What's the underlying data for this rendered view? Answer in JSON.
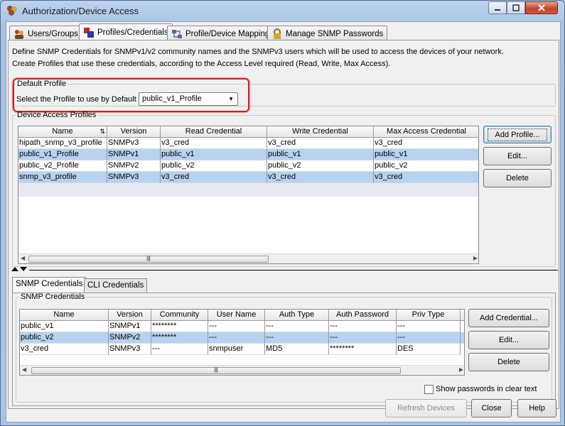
{
  "window": {
    "title": "Authorization/Device Access"
  },
  "tabs": [
    {
      "label": "Users/Groups",
      "icon": "users-icon"
    },
    {
      "label": "Profiles/Credentials",
      "icon": "profiles-icon"
    },
    {
      "label": "Profile/Device Mapping",
      "icon": "mapping-icon"
    },
    {
      "label": "Manage SNMP Passwords",
      "icon": "lock-icon"
    }
  ],
  "description": {
    "line1": "Define SNMP Credentials for SNMPv1/v2 community names and the SNMPv3 users which will be used to access the devices of your network.",
    "line2": "Create Profiles that use these credentials, according to the Access Level required (Read, Write, Max Access)."
  },
  "default_profile": {
    "legend": "Default Profile",
    "label": "Select the Profile to use by Default",
    "selected": "public_v1_Profile"
  },
  "device_profiles": {
    "legend": "Device Access Profiles",
    "columns": [
      "Name",
      "Version",
      "Read Credential",
      "Write Credential",
      "Max Access Credential"
    ],
    "rows": [
      [
        "hipath_snmp_v3_profile",
        "SNMPv3",
        "v3_cred",
        "v3_cred",
        "v3_cred"
      ],
      [
        "public_v1_Profile",
        "SNMPv1",
        "public_v1",
        "public_v1",
        "public_v1"
      ],
      [
        "public_v2_Profile",
        "SNMPv2",
        "public_v2",
        "public_v2",
        "public_v2"
      ],
      [
        "snmp_v3_profile",
        "SNMPv3",
        "v3_cred",
        "v3_cred",
        "v3_cred"
      ]
    ],
    "buttons": {
      "add": "Add Profile...",
      "edit": "Edit...",
      "delete": "Delete"
    }
  },
  "subtabs": [
    "SNMP Credentials",
    "CLI Credentials"
  ],
  "snmp_credentials": {
    "legend": "SNMP Credentials",
    "columns": [
      "Name",
      "Version",
      "Community",
      "User Name",
      "Auth Type",
      "Auth Password",
      "Priv Type"
    ],
    "rows": [
      [
        "public_v1",
        "SNMPv1",
        "********",
        "---",
        "---",
        "---",
        "---"
      ],
      [
        "public_v2",
        "SNMPv2",
        "********",
        "---",
        "---",
        "---",
        "---"
      ],
      [
        "v3_cred",
        "SNMPv3",
        "---",
        "snmpuser",
        "MD5",
        "********",
        "DES"
      ]
    ],
    "buttons": {
      "add": "Add Credential...",
      "edit": "Edit...",
      "delete": "Delete"
    },
    "show_passwords": "Show passwords in clear text"
  },
  "footer": {
    "refresh": "Refresh Devices",
    "close": "Close",
    "help": "Help"
  }
}
